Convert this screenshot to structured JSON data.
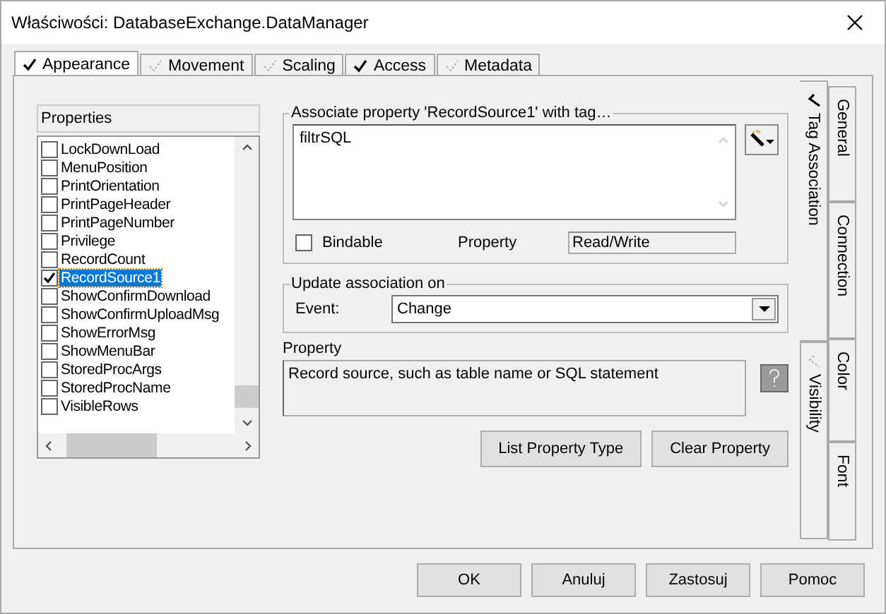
{
  "window": {
    "title": "Właściwości: DatabaseExchange.DataManager"
  },
  "tabs": [
    {
      "label": "Appearance",
      "checked": true,
      "selected": true
    },
    {
      "label": "Movement",
      "checked": false,
      "selected": false
    },
    {
      "label": "Scaling",
      "checked": false,
      "selected": false
    },
    {
      "label": "Access",
      "checked": true,
      "selected": false
    },
    {
      "label": "Metadata",
      "checked": false,
      "selected": false
    }
  ],
  "properties": {
    "header": "Properties",
    "items": [
      {
        "label": "LockDownLoad",
        "checked": false,
        "selected": false
      },
      {
        "label": "MenuPosition",
        "checked": false,
        "selected": false
      },
      {
        "label": "PrintOrientation",
        "checked": false,
        "selected": false
      },
      {
        "label": "PrintPageHeader",
        "checked": false,
        "selected": false
      },
      {
        "label": "PrintPageNumber",
        "checked": false,
        "selected": false
      },
      {
        "label": "Privilege",
        "checked": false,
        "selected": false
      },
      {
        "label": "RecordCount",
        "checked": false,
        "selected": false
      },
      {
        "label": "RecordSource1",
        "checked": true,
        "selected": true
      },
      {
        "label": "ShowConfirmDownload",
        "checked": false,
        "selected": false
      },
      {
        "label": "ShowConfirmUploadMsg",
        "checked": false,
        "selected": false
      },
      {
        "label": "ShowErrorMsg",
        "checked": false,
        "selected": false
      },
      {
        "label": "ShowMenuBar",
        "checked": false,
        "selected": false
      },
      {
        "label": "StoredProcArgs",
        "checked": false,
        "selected": false
      },
      {
        "label": "StoredProcName",
        "checked": false,
        "selected": false
      },
      {
        "label": "VisibleRows",
        "checked": false,
        "selected": false
      }
    ]
  },
  "association": {
    "legend": "Associate property 'RecordSource1' with tag…",
    "tag": "filtrSQL",
    "bindable": {
      "label": "Bindable",
      "checked": false
    },
    "property_label": "Property",
    "access": "Read/Write"
  },
  "update": {
    "legend": "Update association on",
    "event_label": "Event:",
    "event": "Change"
  },
  "description": {
    "label": "Property",
    "text": "Record source, such as table name or SQL statement"
  },
  "actions": [
    "List Property Type",
    "Clear Property"
  ],
  "side_tabs_inner": [
    {
      "label": "Tag Association",
      "checked": true,
      "selected": true
    },
    {
      "label": "Visibility",
      "checked": false,
      "selected": false
    }
  ],
  "side_tabs_outer": [
    {
      "label": "General",
      "selected": false
    },
    {
      "label": "Connection",
      "selected": false
    },
    {
      "label": "Color",
      "selected": false
    },
    {
      "label": "Font",
      "selected": false
    }
  ],
  "buttons": [
    "OK",
    "Anuluj",
    "Zastosuj",
    "Pomoc"
  ]
}
